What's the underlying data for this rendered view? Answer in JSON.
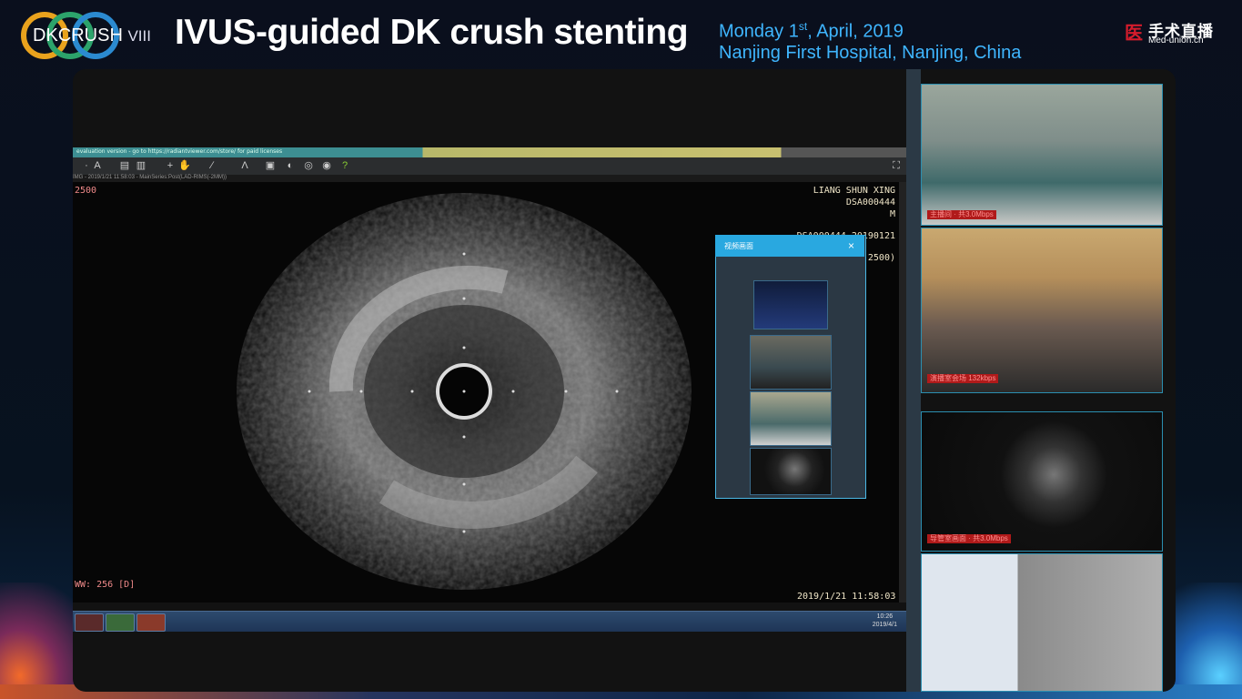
{
  "header": {
    "logo_text": "DKCRUSH",
    "logo_sub": "VIII",
    "title": "IVUS-guided DK crush stenting",
    "date_day": "Monday 1",
    "date_sup": "st",
    "date_rest": ", April, 2019",
    "location": "Nanjing First Hospital, Nanjing, China",
    "brand_cn": "手术直播",
    "brand_en": "Med-union.cn",
    "brand_mark": "医"
  },
  "software": {
    "titlebar_text": "evaluation version - go to https://radiantviewer.com/store/ for paid licenses",
    "infobar_text": "IMG - 2019/1/21 11:58:03 - MainSeries:Post(LAD-RIMS(-2MM))",
    "frame_label": "2500",
    "patient_name": "LIANG SHUN XING",
    "patient_id": "DSA000444",
    "patient_sex": "M",
    "study_id": "DSA000444-20190121",
    "study_num": "2500)",
    "window_width": "WW: 256 [D]",
    "timestamp": "2019/1/21 11:58:03",
    "tray_time": "10:26",
    "tray_date": "2019/4/1"
  },
  "popup": {
    "title": "视频画面",
    "close": "×"
  },
  "right_panels": {
    "p1_label": "主播间 · 共3.0Mbps",
    "p2_label": "演播室会场 132kbps",
    "p3_label": "导管室画面 · 共3.0Mbps"
  },
  "colors": {
    "accent_blue": "#3fb6ff",
    "brand_red": "#d61c2c",
    "frame_border": "#2b8fb0"
  }
}
